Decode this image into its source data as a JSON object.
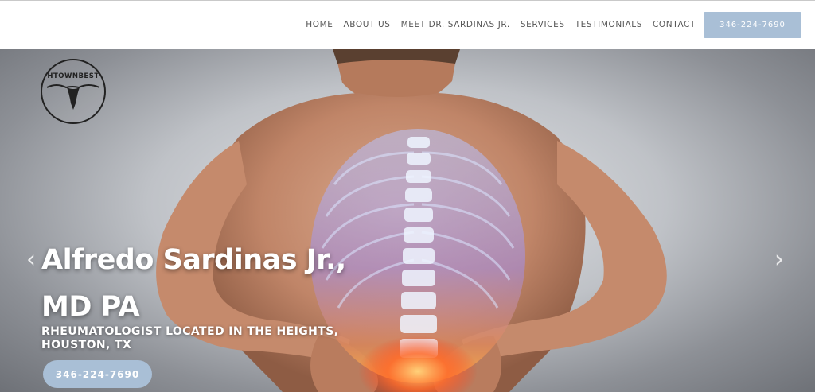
{
  "header": {
    "nav": [
      {
        "label": "HOME"
      },
      {
        "label": "ABOUT US"
      },
      {
        "label": "MEET DR. SARDINAS JR."
      },
      {
        "label": "SERVICES"
      },
      {
        "label": "TESTIMONIALS"
      },
      {
        "label": "CONTACT"
      }
    ],
    "phone_button": "346-224-7690"
  },
  "hero": {
    "logo_text": "HTOWNBEST",
    "title": "Alfredo Sardinas Jr., MD PA",
    "subtitle": "RHEUMATOLOGIST LOCATED IN THE HEIGHTS, HOUSTON, TX",
    "phone_button": "346-224-7690",
    "prev_icon": "chevron-left",
    "next_icon": "chevron-right"
  },
  "colors": {
    "accent": "#a9bfd6",
    "nav_text": "#555555",
    "hero_text": "#ffffff"
  }
}
